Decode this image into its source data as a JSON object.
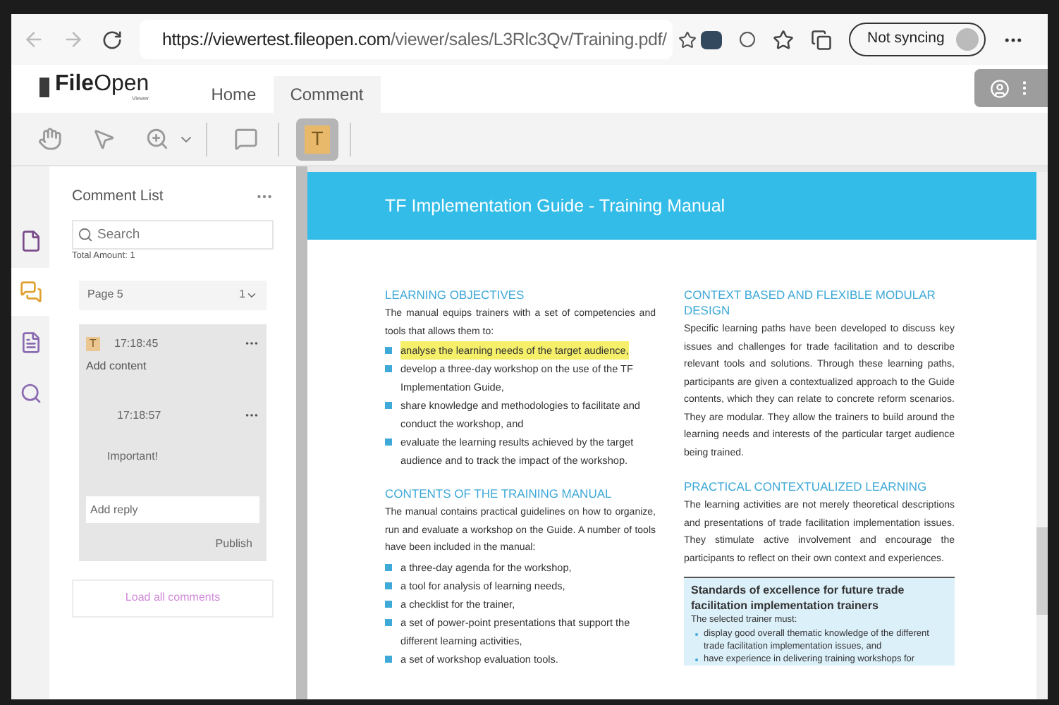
{
  "browser": {
    "url_host": "https://viewertest.fileopen.com",
    "url_path": "/viewer/sales/L3Rlc3Qv/Training.pdf/",
    "profile_label": "Not syncing"
  },
  "app": {
    "logo_bold": "File",
    "logo_light": "Open",
    "logo_sub": "Viewer",
    "tabs": [
      {
        "label": "Home",
        "selected": false
      },
      {
        "label": "Comment",
        "selected": true
      }
    ]
  },
  "toolbar": [
    {
      "kind": "hand",
      "selected": false
    },
    {
      "kind": "pointer",
      "selected": false
    },
    {
      "kind": "zoom",
      "selected": false
    },
    {
      "kind": "comment",
      "selected": false
    },
    {
      "kind": "text",
      "selected": true,
      "label": "T"
    }
  ],
  "side_rail": [
    {
      "kind": "thumbnails",
      "selected": false
    },
    {
      "kind": "comments",
      "selected": true
    },
    {
      "kind": "page",
      "selected": false
    },
    {
      "kind": "search",
      "selected": false
    }
  ],
  "comment_panel": {
    "title": "Comment List",
    "search_placeholder": "Search",
    "total": "Total Amount: 1",
    "page_group": {
      "label": "Page 5",
      "count": "1"
    },
    "comment": {
      "badge": "T",
      "time": "17:18:45",
      "content": "Add content",
      "reply": {
        "time": "17:18:57",
        "content": "Important!"
      },
      "reply_placeholder": "Add reply",
      "publish": "Publish"
    },
    "load_all": "Load all comments"
  },
  "document": {
    "header": "TF Implementation Guide - Training Manual",
    "left": [
      {
        "kind": "heading",
        "text": "LEARNING OBJECTIVES"
      },
      {
        "kind": "para",
        "text": "The manual equips trainers with a set of competencies and tools that allows them to:"
      },
      {
        "kind": "bullet",
        "text": "analyse the learning needs of the target audience,",
        "highlighted": true
      },
      {
        "kind": "bullet",
        "text": "develop a three-day workshop on the use of the TF Implementation Guide,",
        "highlighted": false
      },
      {
        "kind": "bullet",
        "text": "share knowledge and methodologies to facilitate and conduct the workshop, and",
        "highlighted": false
      },
      {
        "kind": "bullet",
        "text": "evaluate the learning results achieved by the target audience and to track the impact of the workshop.",
        "highlighted": false
      },
      {
        "kind": "heading",
        "text": "CONTENTS OF THE TRAINING MANUAL"
      },
      {
        "kind": "para",
        "text": "The manual contains practical guidelines on how to organize, run and evaluate a workshop on the Guide. A number of tools have been included in the manual:"
      },
      {
        "kind": "bullet",
        "text": "a three-day agenda for the workshop,",
        "highlighted": false
      },
      {
        "kind": "bullet",
        "text": "a tool for analysis of learning needs,",
        "highlighted": false
      },
      {
        "kind": "bullet",
        "text": "a checklist for the trainer,",
        "highlighted": false
      },
      {
        "kind": "bullet",
        "text": "a set of power-point presentations that support the different learning activities,",
        "highlighted": false
      },
      {
        "kind": "bullet",
        "text": "a set of workshop evaluation tools.",
        "highlighted": false
      }
    ],
    "right": [
      {
        "kind": "heading",
        "text": "CONTEXT BASED AND FLEXIBLE MODULAR DESIGN"
      },
      {
        "kind": "para",
        "text": "Specific learning paths have been developed to discuss key issues and challenges for trade facilitation and to describe relevant tools and solutions. Through these learning paths, participants are given a contextualized approach to the Guide contents, which they can relate to concrete reform scenarios. They are modular. They allow the trainers to build around the learning needs and interests of the particular target audience being trained."
      },
      {
        "kind": "heading",
        "text": "PRACTICAL CONTEXTUALIZED LEARNING"
      },
      {
        "kind": "para",
        "text": "The learning activities are not merely theoretical descriptions and presentations of trade facilitation implementation issues. They stimulate active involvement and encourage the participants to reflect on their own context and experiences."
      }
    ],
    "box": {
      "title": "Standards of excellence for future trade facilitation implementation trainers",
      "intro": "The selected trainer must:",
      "items": [
        "display good overall thematic knowledge of the different trade facilitation implementation issues, and",
        "have experience in delivering training workshops for"
      ]
    }
  }
}
